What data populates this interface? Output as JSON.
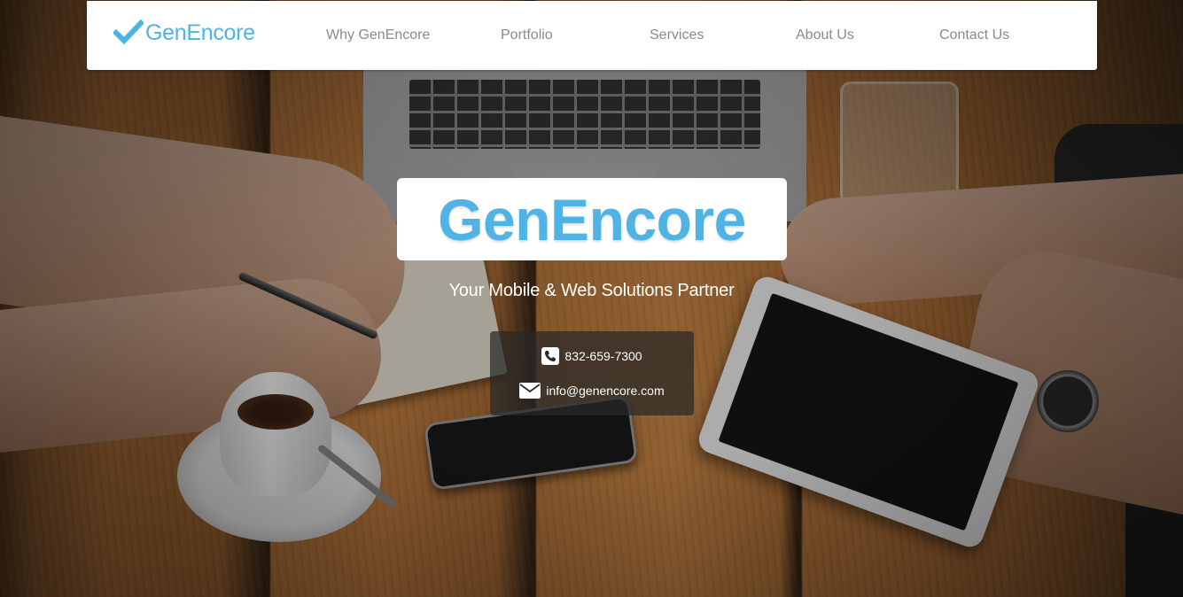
{
  "navbar": {
    "brand_name": "GenEncore",
    "brand_icon": "checkmark-icon",
    "items": [
      {
        "label": "Why GenEncore"
      },
      {
        "label": "Portfolio"
      },
      {
        "label": "Services"
      },
      {
        "label": "About Us"
      },
      {
        "label": "Contact Us"
      }
    ]
  },
  "hero": {
    "title": "GenEncore",
    "tagline": "Your Mobile & Web Solutions Partner",
    "background_image": "coworkers-at-wooden-table-with-laptop-tablet-phone-coffee"
  },
  "contact": {
    "phone": "832-659-7300",
    "phone_icon": "phone-icon",
    "email": "info@genencore.com",
    "email_icon": "envelope-icon"
  },
  "colors": {
    "brand_blue": "#4fb3e6",
    "nav_text": "#8a8a8a",
    "navbar_bg": "#ffffff",
    "contact_box_bg": "rgba(40,40,40,0.72)"
  }
}
